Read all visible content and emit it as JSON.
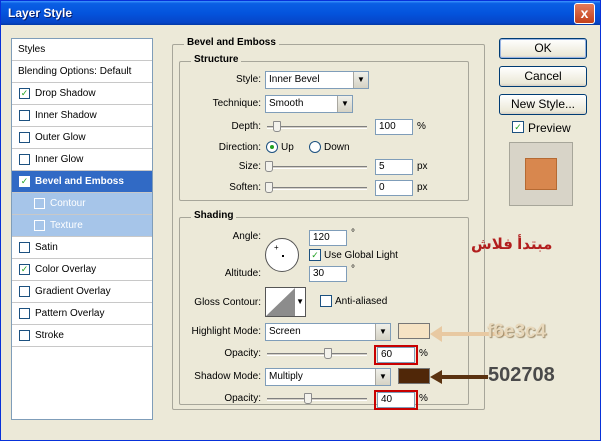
{
  "window": {
    "title": "Layer Style",
    "close_glyph": "x"
  },
  "styles_list": {
    "header": "Styles",
    "blending": "Blending Options: Default",
    "items": [
      {
        "label": "Drop Shadow",
        "checked": true
      },
      {
        "label": "Inner Shadow",
        "checked": false
      },
      {
        "label": "Outer Glow",
        "checked": false
      },
      {
        "label": "Inner Glow",
        "checked": false
      },
      {
        "label": "Bevel and Emboss",
        "checked": true
      },
      {
        "label": "Contour",
        "checked": false
      },
      {
        "label": "Texture",
        "checked": false
      },
      {
        "label": "Satin",
        "checked": false
      },
      {
        "label": "Color Overlay",
        "checked": true
      },
      {
        "label": "Gradient Overlay",
        "checked": false
      },
      {
        "label": "Pattern Overlay",
        "checked": false
      },
      {
        "label": "Stroke",
        "checked": false
      }
    ]
  },
  "bevel": {
    "title": "Bevel and Emboss",
    "structure": {
      "title": "Structure",
      "style_label": "Style:",
      "style_value": "Inner Bevel",
      "technique_label": "Technique:",
      "technique_value": "Smooth",
      "depth_label": "Depth:",
      "depth_value": "100",
      "depth_unit": "%",
      "direction_label": "Direction:",
      "up_label": "Up",
      "down_label": "Down",
      "size_label": "Size:",
      "size_value": "5",
      "size_unit": "px",
      "soften_label": "Soften:",
      "soften_value": "0",
      "soften_unit": "px"
    },
    "shading": {
      "title": "Shading",
      "angle_label": "Angle:",
      "angle_value": "120",
      "angle_unit": "°",
      "global_light_label": "Use Global Light",
      "altitude_label": "Altitude:",
      "altitude_value": "30",
      "altitude_unit": "°",
      "gloss_label": "Gloss Contour:",
      "antialiased_label": "Anti-aliased",
      "highlight_label": "Highlight Mode:",
      "highlight_value": "Screen",
      "highlight_opacity_label": "Opacity:",
      "highlight_opacity_value": "60",
      "highlight_opacity_unit": "%",
      "shadow_label": "Shadow Mode:",
      "shadow_value": "Multiply",
      "shadow_opacity_label": "Opacity:",
      "shadow_opacity_value": "40",
      "shadow_opacity_unit": "%"
    }
  },
  "buttons": {
    "ok": "OK",
    "cancel": "Cancel",
    "new_style": "New Style...",
    "preview": "Preview"
  },
  "colors": {
    "highlight": "#f6e3c4",
    "shadow": "#502708",
    "preview_fill": "#d8874e",
    "title_bar": "#0454dd",
    "selection": "#316ac5"
  },
  "annotations": {
    "arabic": "مبتدأ فلاش",
    "highlight_hex": "f6e3c4",
    "shadow_hex": "502708"
  }
}
